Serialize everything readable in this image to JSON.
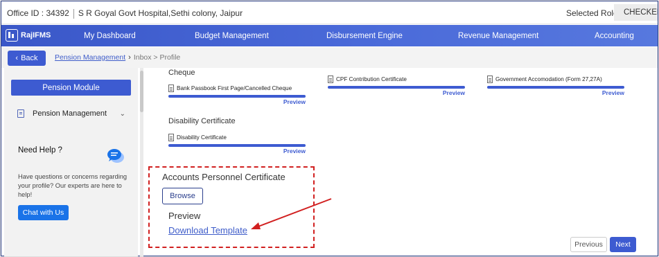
{
  "header": {
    "office_text": "Office ID : 34392",
    "hospital_text": "S R Goyal Govt Hospital,Sethi colony, Jaipur",
    "selected_role_label": "Selected Role",
    "selected_role_value": "CHECKER"
  },
  "nav": {
    "logo_text": "RajIFMS",
    "items": [
      "My Dashboard",
      "Budget Management",
      "Disbursement Engine",
      "Revenue Management",
      "Accounting"
    ]
  },
  "breadcrumb": {
    "back_label": "Back",
    "link": "Pension Management",
    "rest": "Inbox > Profile"
  },
  "sidebar": {
    "module_label": "Pension Module",
    "pension_management": "Pension Management",
    "help_title": "Need Help ?",
    "help_text": "Have questions or concerns regarding your profile? Our experts are here to help!",
    "chat_label": "Chat with Us"
  },
  "documents": {
    "cheque_title": "Cheque",
    "cheque_doc": "Bank Passbook First Page/Cancelled Cheque",
    "cpf_doc": "CPF Contribution Certificate",
    "gov_doc": "Government Accomodation (Form 27,27A)",
    "disability_title": "Disability Certificate",
    "disability_doc": "Disability Certificate",
    "preview_label": "Preview"
  },
  "accounts": {
    "title": "Accounts Personnel Certificate",
    "browse_label": "Browse",
    "preview_label": "Preview",
    "download_label": "Download Template"
  },
  "footer": {
    "previous_label": "Previous",
    "next_label": "Next"
  },
  "colors": {
    "primary": "#3d5bd1",
    "annotation_red": "#d11f1f"
  }
}
